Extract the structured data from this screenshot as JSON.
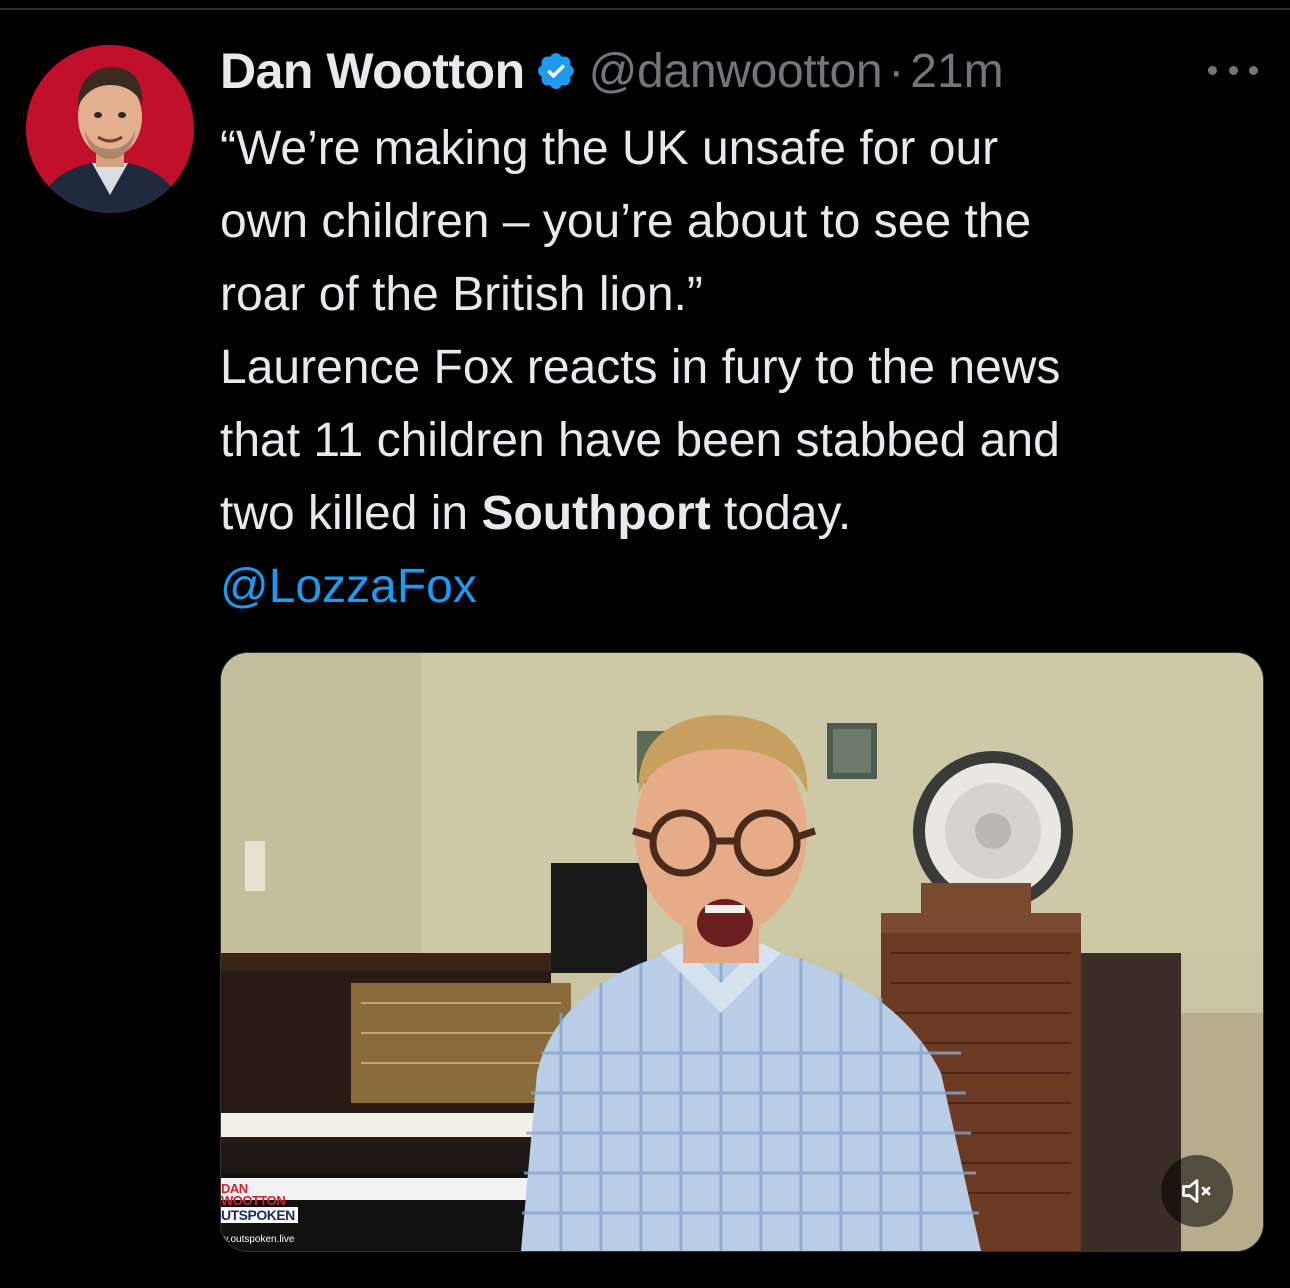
{
  "tweet": {
    "display_name": "Dan Wootton",
    "verified_icon": "verified-badge-icon",
    "handle": "@danwootton",
    "separator": "·",
    "time": "21m",
    "more_icon": "more-horizontal-icon",
    "text_lines": [
      "“We’re making the UK unsafe for our",
      "own children – you’re about to see the",
      "roar of the British lion.”",
      "Laurence Fox reacts in fury to the news",
      "that 11 children have been stabbed and"
    ],
    "last_line_before": "two killed in ",
    "last_line_bold": "Southport",
    "last_line_after": " today.",
    "mention": "@LozzaFox"
  },
  "media": {
    "watermark_line1": "DAN",
    "watermark_line2": "WOOTTON",
    "watermark_line3": "UTSPOKEN",
    "watermark_url": "w.outspoken.live",
    "mute_icon": "volume-muted-icon"
  },
  "colors": {
    "background": "#000000",
    "text": "#e7e9ea",
    "secondary": "#71767b",
    "link": "#1d9bf0",
    "verified": "#1d9bf0",
    "avatar_bg": "#c0102c"
  }
}
